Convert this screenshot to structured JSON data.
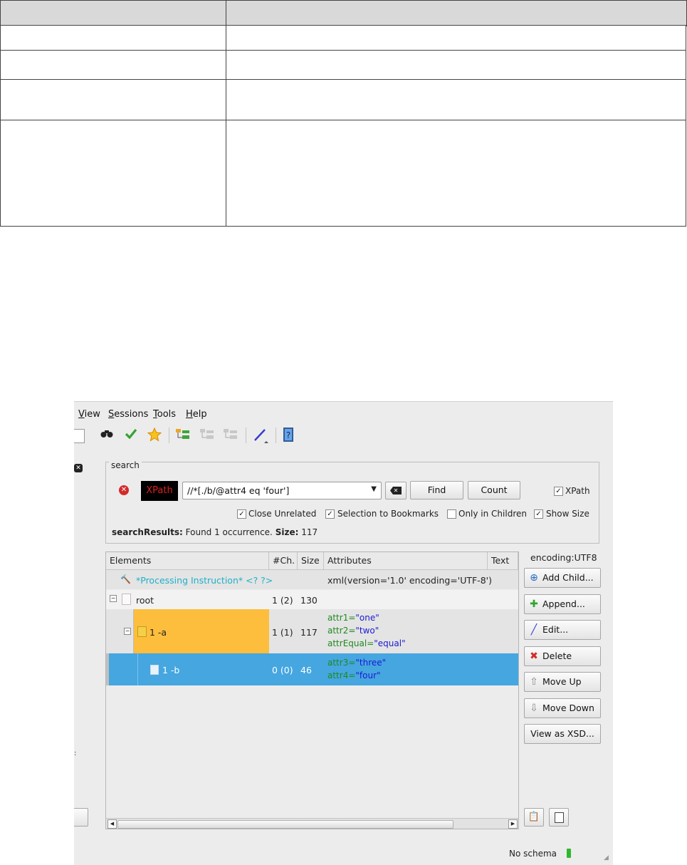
{
  "menu": {
    "items": [
      "View",
      "Sessions",
      "Tools",
      "Help"
    ]
  },
  "toolbar": {
    "icons": [
      "binoculars-icon",
      "check-icon",
      "star-icon",
      "tree-add-icon",
      "tree-remove-icon",
      "tree-move-icon",
      "pen-icon",
      "help-book-icon"
    ]
  },
  "search": {
    "legend": "search",
    "mode_badge": "XPath",
    "query": "//*[./b/@attr4  eq 'four']",
    "find_label": "Find",
    "count_label": "Count",
    "xpath_checkbox_label": "XPath",
    "options": [
      {
        "label": "Close Unrelated",
        "checked": true
      },
      {
        "label": "Selection to Bookmarks",
        "checked": true
      },
      {
        "label": "Only in Children",
        "checked": false
      },
      {
        "label": "Show Size",
        "checked": true
      }
    ],
    "results_label": "searchResults:",
    "results_text": "Found 1 occurrence.",
    "size_label": "Size:",
    "size_value": "117"
  },
  "tree": {
    "columns": [
      "Elements",
      "#Ch.",
      "Size",
      "Attributes",
      "Text"
    ],
    "rows": [
      {
        "element": "*Processing Instruction* <? ?>",
        "children": "",
        "size": "",
        "attributes": "xml(version='1.0' encoding='UTF-8')"
      },
      {
        "element": "root",
        "children": "1 (2)",
        "size": "130",
        "attributes": ""
      },
      {
        "element": "1 -a",
        "children": "1 (1)",
        "size": "117",
        "attrs": [
          {
            "n": "attr1=",
            "v": "\"one\""
          },
          {
            "n": "attr2=",
            "v": "\"two\""
          },
          {
            "n": "attrEqual=",
            "v": "\"equal\""
          }
        ]
      },
      {
        "element": "1 -b",
        "children": "0 (0)",
        "size": "46",
        "attrs": [
          {
            "n": "attr3=",
            "v": "\"three\""
          },
          {
            "n": "attr4=",
            "v": "\"four\""
          }
        ]
      }
    ]
  },
  "side": {
    "encoding": "encoding:UTF8",
    "buttons": [
      "Add Child...",
      "Append...",
      "Edit...",
      "Delete",
      "Move Up",
      "Move Down",
      "View as XSD..."
    ]
  },
  "status": {
    "schema": "No schema"
  },
  "colors": {
    "selected_row": "#45a6e0",
    "highlight_row": "#fcbe3c",
    "xpath_badge_bg": "#000000",
    "xpath_badge_fg": "#e02020"
  }
}
